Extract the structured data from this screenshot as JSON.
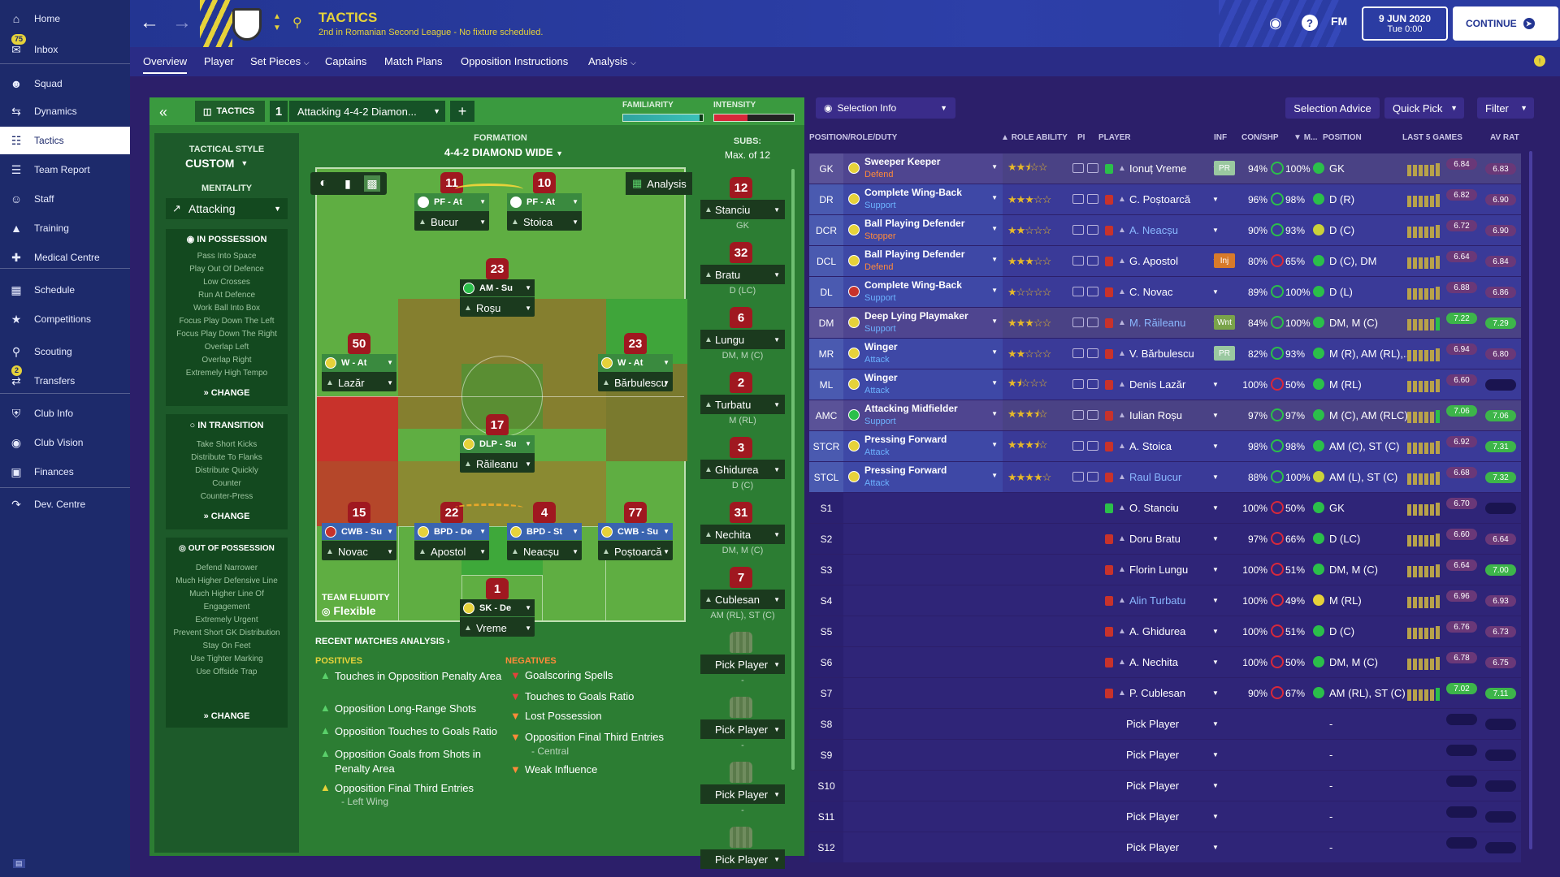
{
  "sidebar": {
    "items": [
      {
        "label": "Home",
        "icon": "home-icon"
      },
      {
        "label": "Inbox",
        "icon": "inbox-icon",
        "badge": "75"
      },
      {
        "label": "Squad",
        "icon": "squad-icon"
      },
      {
        "label": "Dynamics",
        "icon": "dynamics-icon"
      },
      {
        "label": "Tactics",
        "icon": "tactics-icon",
        "active": true
      },
      {
        "label": "Team Report",
        "icon": "report-icon"
      },
      {
        "label": "Staff",
        "icon": "staff-icon"
      },
      {
        "label": "Training",
        "icon": "training-icon"
      },
      {
        "label": "Medical Centre",
        "icon": "medical-icon"
      },
      {
        "label": "Schedule",
        "icon": "schedule-icon"
      },
      {
        "label": "Competitions",
        "icon": "trophy-icon"
      },
      {
        "label": "Scouting",
        "icon": "scouting-icon"
      },
      {
        "label": "Transfers",
        "icon": "transfers-icon",
        "badge": "2"
      },
      {
        "label": "Club Info",
        "icon": "club-info-icon"
      },
      {
        "label": "Club Vision",
        "icon": "club-vision-icon"
      },
      {
        "label": "Finances",
        "icon": "finances-icon"
      },
      {
        "label": "Dev. Centre",
        "icon": "dev-centre-icon"
      }
    ]
  },
  "header": {
    "title": "TACTICS",
    "subtitle": "2nd in Romanian Second League - No fixture scheduled.",
    "fm": "FM",
    "date": "9 JUN 2020",
    "time": "Tue 0:00",
    "continue": "CONTINUE"
  },
  "tabs": [
    "Overview",
    "Player",
    "Set Pieces",
    "Captains",
    "Match Plans",
    "Opposition Instructions",
    "Analysis"
  ],
  "tactic": {
    "tab_label": "TACTICS",
    "slot": "1",
    "name": "Attacking 4-4-2 Diamon...",
    "familiarity_label": "FAMILIARITY",
    "intensity_label": "INTENSITY",
    "style_label": "TACTICAL STYLE",
    "style": "CUSTOM",
    "mentality_label": "MENTALITY",
    "mentality": "Attacking",
    "formation_label": "FORMATION",
    "formation": "4-4-2 DIAMOND WIDE",
    "subs_label": "SUBS:",
    "subs_max": "Max. of 12",
    "analysis_btn": "Analysis",
    "fluidity_label": "TEAM FLUIDITY",
    "fluidity": "Flexible",
    "change": "CHANGE",
    "in_possession": {
      "title": "IN POSSESSION",
      "items": [
        "Pass Into Space",
        "Play Out Of Defence",
        "Low Crosses",
        "Run At Defence",
        "Work Ball Into Box",
        "Focus Play Down The Left",
        "Focus Play Down The Right",
        "Overlap Left",
        "Overlap Right",
        "Extremely High Tempo"
      ]
    },
    "in_transition": {
      "title": "IN TRANSITION",
      "items": [
        "Take Short Kicks",
        "Distribute To Flanks",
        "Distribute Quickly",
        "Counter",
        "Counter-Press"
      ]
    },
    "out_possession": {
      "title": "OUT OF POSSESSION",
      "items": [
        "Defend Narrower",
        "Much Higher Defensive Line",
        "Much Higher Line Of Engagement",
        "Extremely Urgent",
        "Prevent Short GK Distribution",
        "Stay On Feet",
        "Use Tighter Marking",
        "Use Offside Trap"
      ]
    }
  },
  "pitch_players": [
    {
      "num": "11",
      "role": "PF - At",
      "name": "Bucur"
    },
    {
      "num": "10",
      "role": "PF - At",
      "name": "Stoica"
    },
    {
      "num": "23",
      "role": "AM - Su",
      "name": "Roșu"
    },
    {
      "num": "50",
      "role": "W - At",
      "name": "Lazăr"
    },
    {
      "num": "23",
      "role": "W - At",
      "name": "Bărbulescu"
    },
    {
      "num": "17",
      "role": "DLP - Su",
      "name": "Răileanu"
    },
    {
      "num": "15",
      "role": "CWB - Su",
      "name": "Novac"
    },
    {
      "num": "22",
      "role": "BPD - De",
      "name": "Apostol"
    },
    {
      "num": "4",
      "role": "BPD - St",
      "name": "Neacșu"
    },
    {
      "num": "77",
      "role": "CWB - Su",
      "name": "Poștoarcă"
    },
    {
      "num": "1",
      "role": "SK - De",
      "name": "Vreme"
    }
  ],
  "subs": [
    {
      "num": "12",
      "name": "Stanciu",
      "pos": "GK"
    },
    {
      "num": "32",
      "name": "Bratu",
      "pos": "D (LC)"
    },
    {
      "num": "6",
      "name": "Lungu",
      "pos": "DM, M (C)"
    },
    {
      "num": "2",
      "name": "Turbatu",
      "pos": "M (RL)"
    },
    {
      "num": "3",
      "name": "Ghidurea",
      "pos": "D (C)"
    },
    {
      "num": "31",
      "name": "Nechita",
      "pos": "DM, M (C)"
    },
    {
      "num": "7",
      "name": "Cublesan",
      "pos": "AM (RL), ST (C)"
    },
    {
      "num": "",
      "name": "Pick Player",
      "pos": "-"
    },
    {
      "num": "",
      "name": "Pick Player",
      "pos": "-"
    },
    {
      "num": "",
      "name": "Pick Player",
      "pos": "-"
    },
    {
      "num": "",
      "name": "Pick Player",
      "pos": ""
    }
  ],
  "analysis": {
    "title": "RECENT MATCHES ANALYSIS",
    "positives_label": "POSITIVES",
    "negatives_label": "NEGATIVES",
    "positives": [
      "Touches in Opposition Penalty Area",
      "Opposition Long-Range Shots",
      "Opposition Touches to Goals Ratio",
      "Opposition Goals from Shots in Penalty Area",
      "Opposition Final Third Entries"
    ],
    "positives_sub": "- Left Wing",
    "negatives": [
      "Goalscoring Spells",
      "Touches to Goals Ratio",
      "Lost Possession",
      "Opposition Final Third Entries",
      "Weak Influence"
    ],
    "negatives_sub": "- Central"
  },
  "selection": {
    "info": "Selection Info",
    "advice": "Selection Advice",
    "quick_pick": "Quick Pick",
    "filter": "Filter"
  },
  "table_headers": {
    "position": "POSITION/ROLE/DUTY",
    "role_ability": "ROLE ABILITY",
    "pi": "PI",
    "player": "PLAYER",
    "inf": "INF",
    "con": "CON/SHP",
    "m": "M...",
    "pos": "POSITION",
    "last5": "LAST 5 GAMES",
    "avrat": "AV RAT"
  },
  "squad": [
    {
      "slot": "GK",
      "role": "Sweeper Keeper",
      "duty": "Defend",
      "dutyc": "#ff8a3a",
      "stars": 2.5,
      "player": "Ionuț Vreme",
      "inf": "PR",
      "con": "94%",
      "shp": "100%",
      "pos": "GK",
      "last": "6.84",
      "avg": "6.83",
      "hl": true
    },
    {
      "slot": "DR",
      "role": "Complete Wing-Back",
      "duty": "Support",
      "dutyc": "#6cb2ff",
      "stars": 3,
      "player": "C. Poștoarcă",
      "inf": "",
      "con": "96%",
      "shp": "98%",
      "pos": "D (R)",
      "last": "6.82",
      "avg": "6.90",
      "hl": false
    },
    {
      "slot": "DCR",
      "role": "Ball Playing Defender",
      "duty": "Stopper",
      "dutyc": "#ff8a3a",
      "stars": 2,
      "player": "A. Neacșu",
      "inf": "",
      "con": "90%",
      "shp": "93%",
      "pos": "D (C)",
      "last": "6.72",
      "avg": "6.90",
      "hl": false
    },
    {
      "slot": "DCL",
      "role": "Ball Playing Defender",
      "duty": "Defend",
      "dutyc": "#ff8a3a",
      "stars": 3,
      "player": "G. Apostol",
      "inf": "Inj",
      "con": "80%",
      "shp": "65%",
      "pos": "D (C), DM",
      "last": "6.64",
      "avg": "6.84",
      "hl": false
    },
    {
      "slot": "DL",
      "role": "Complete Wing-Back",
      "duty": "Support",
      "dutyc": "#6cb2ff",
      "stars": 1,
      "player": "C. Novac",
      "inf": "",
      "con": "89%",
      "shp": "100%",
      "pos": "D (L)",
      "last": "6.88",
      "avg": "6.86",
      "hl": false
    },
    {
      "slot": "DM",
      "role": "Deep Lying Playmaker",
      "duty": "Support",
      "dutyc": "#6cb2ff",
      "stars": 3,
      "player": "M. Răileanu",
      "inf": "Wnt",
      "con": "84%",
      "shp": "100%",
      "pos": "DM, M (C)",
      "last": "7.22",
      "avg": "7.29",
      "hl": true
    },
    {
      "slot": "MR",
      "role": "Winger",
      "duty": "Attack",
      "dutyc": "#6cb2ff",
      "stars": 2,
      "player": "V. Bărbulescu",
      "inf": "PR",
      "con": "82%",
      "shp": "93%",
      "pos": "M (R), AM (RL),...",
      "last": "6.94",
      "avg": "6.80",
      "hl": false
    },
    {
      "slot": "ML",
      "role": "Winger",
      "duty": "Attack",
      "dutyc": "#6cb2ff",
      "stars": 1.5,
      "player": "Denis Lazăr",
      "inf": "",
      "con": "100%",
      "shp": "50%",
      "pos": "M (RL)",
      "last": "6.60",
      "avg": "",
      "hl": false
    },
    {
      "slot": "AMC",
      "role": "Attacking Midfielder",
      "duty": "Support",
      "dutyc": "#6cb2ff",
      "stars": 3.5,
      "player": "Iulian Roșu",
      "inf": "",
      "con": "97%",
      "shp": "97%",
      "pos": "M (C), AM (RLC)",
      "last": "7.06",
      "avg": "7.06",
      "hl": true
    },
    {
      "slot": "STCR",
      "role": "Pressing Forward",
      "duty": "Attack",
      "dutyc": "#6cb2ff",
      "stars": 3.5,
      "player": "A. Stoica",
      "inf": "",
      "con": "98%",
      "shp": "98%",
      "pos": "AM (C), ST (C)",
      "last": "6.92",
      "avg": "7.31",
      "hl": false
    },
    {
      "slot": "STCL",
      "role": "Pressing Forward",
      "duty": "Attack",
      "dutyc": "#6cb2ff",
      "stars": 4,
      "player": "Raul Bucur",
      "inf": "",
      "con": "88%",
      "shp": "100%",
      "pos": "AM (L), ST (C)",
      "last": "6.68",
      "avg": "7.32",
      "hl": false
    },
    {
      "slot": "S1",
      "role": "",
      "duty": "",
      "stars": 0,
      "player": "O. Stanciu",
      "inf": "",
      "con": "100%",
      "shp": "50%",
      "pos": "GK",
      "last": "6.70",
      "avg": ""
    },
    {
      "slot": "S2",
      "role": "",
      "duty": "",
      "stars": 0,
      "player": "Doru Bratu",
      "inf": "",
      "con": "97%",
      "shp": "66%",
      "pos": "D (LC)",
      "last": "6.60",
      "avg": "6.64"
    },
    {
      "slot": "S3",
      "role": "",
      "duty": "",
      "stars": 0,
      "player": "Florin Lungu",
      "inf": "",
      "con": "100%",
      "shp": "51%",
      "pos": "DM, M (C)",
      "last": "6.64",
      "avg": "7.00"
    },
    {
      "slot": "S4",
      "role": "",
      "duty": "",
      "stars": 0,
      "player": "Alin Turbatu",
      "inf": "",
      "con": "100%",
      "shp": "49%",
      "pos": "M (RL)",
      "last": "6.96",
      "avg": "6.93"
    },
    {
      "slot": "S5",
      "role": "",
      "duty": "",
      "stars": 0,
      "player": "A. Ghidurea",
      "inf": "",
      "con": "100%",
      "shp": "51%",
      "pos": "D (C)",
      "last": "6.76",
      "avg": "6.73"
    },
    {
      "slot": "S6",
      "role": "",
      "duty": "",
      "stars": 0,
      "player": "A. Nechita",
      "inf": "",
      "con": "100%",
      "shp": "50%",
      "pos": "DM, M (C)",
      "last": "6.78",
      "avg": "6.75"
    },
    {
      "slot": "S7",
      "role": "",
      "duty": "",
      "stars": 0,
      "player": "P. Cublesan",
      "inf": "",
      "con": "90%",
      "shp": "67%",
      "pos": "AM (RL), ST (C)",
      "last": "7.02",
      "avg": "7.11"
    },
    {
      "slot": "S8",
      "role": "",
      "duty": "",
      "stars": 0,
      "player": "Pick Player",
      "inf": "",
      "con": "",
      "shp": "",
      "pos": "-",
      "last": "",
      "avg": ""
    },
    {
      "slot": "S9",
      "role": "",
      "duty": "",
      "stars": 0,
      "player": "Pick Player",
      "inf": "",
      "con": "",
      "shp": "",
      "pos": "-",
      "last": "",
      "avg": ""
    },
    {
      "slot": "S10",
      "role": "",
      "duty": "",
      "stars": 0,
      "player": "Pick Player",
      "inf": "",
      "con": "",
      "shp": "",
      "pos": "-",
      "last": "",
      "avg": ""
    },
    {
      "slot": "S11",
      "role": "",
      "duty": "",
      "stars": 0,
      "player": "Pick Player",
      "inf": "",
      "con": "",
      "shp": "",
      "pos": "-",
      "last": "",
      "avg": ""
    },
    {
      "slot": "S12",
      "role": "",
      "duty": "",
      "stars": 0,
      "player": "Pick Player",
      "inf": "",
      "con": "",
      "shp": "",
      "pos": "-",
      "last": "",
      "avg": ""
    }
  ]
}
